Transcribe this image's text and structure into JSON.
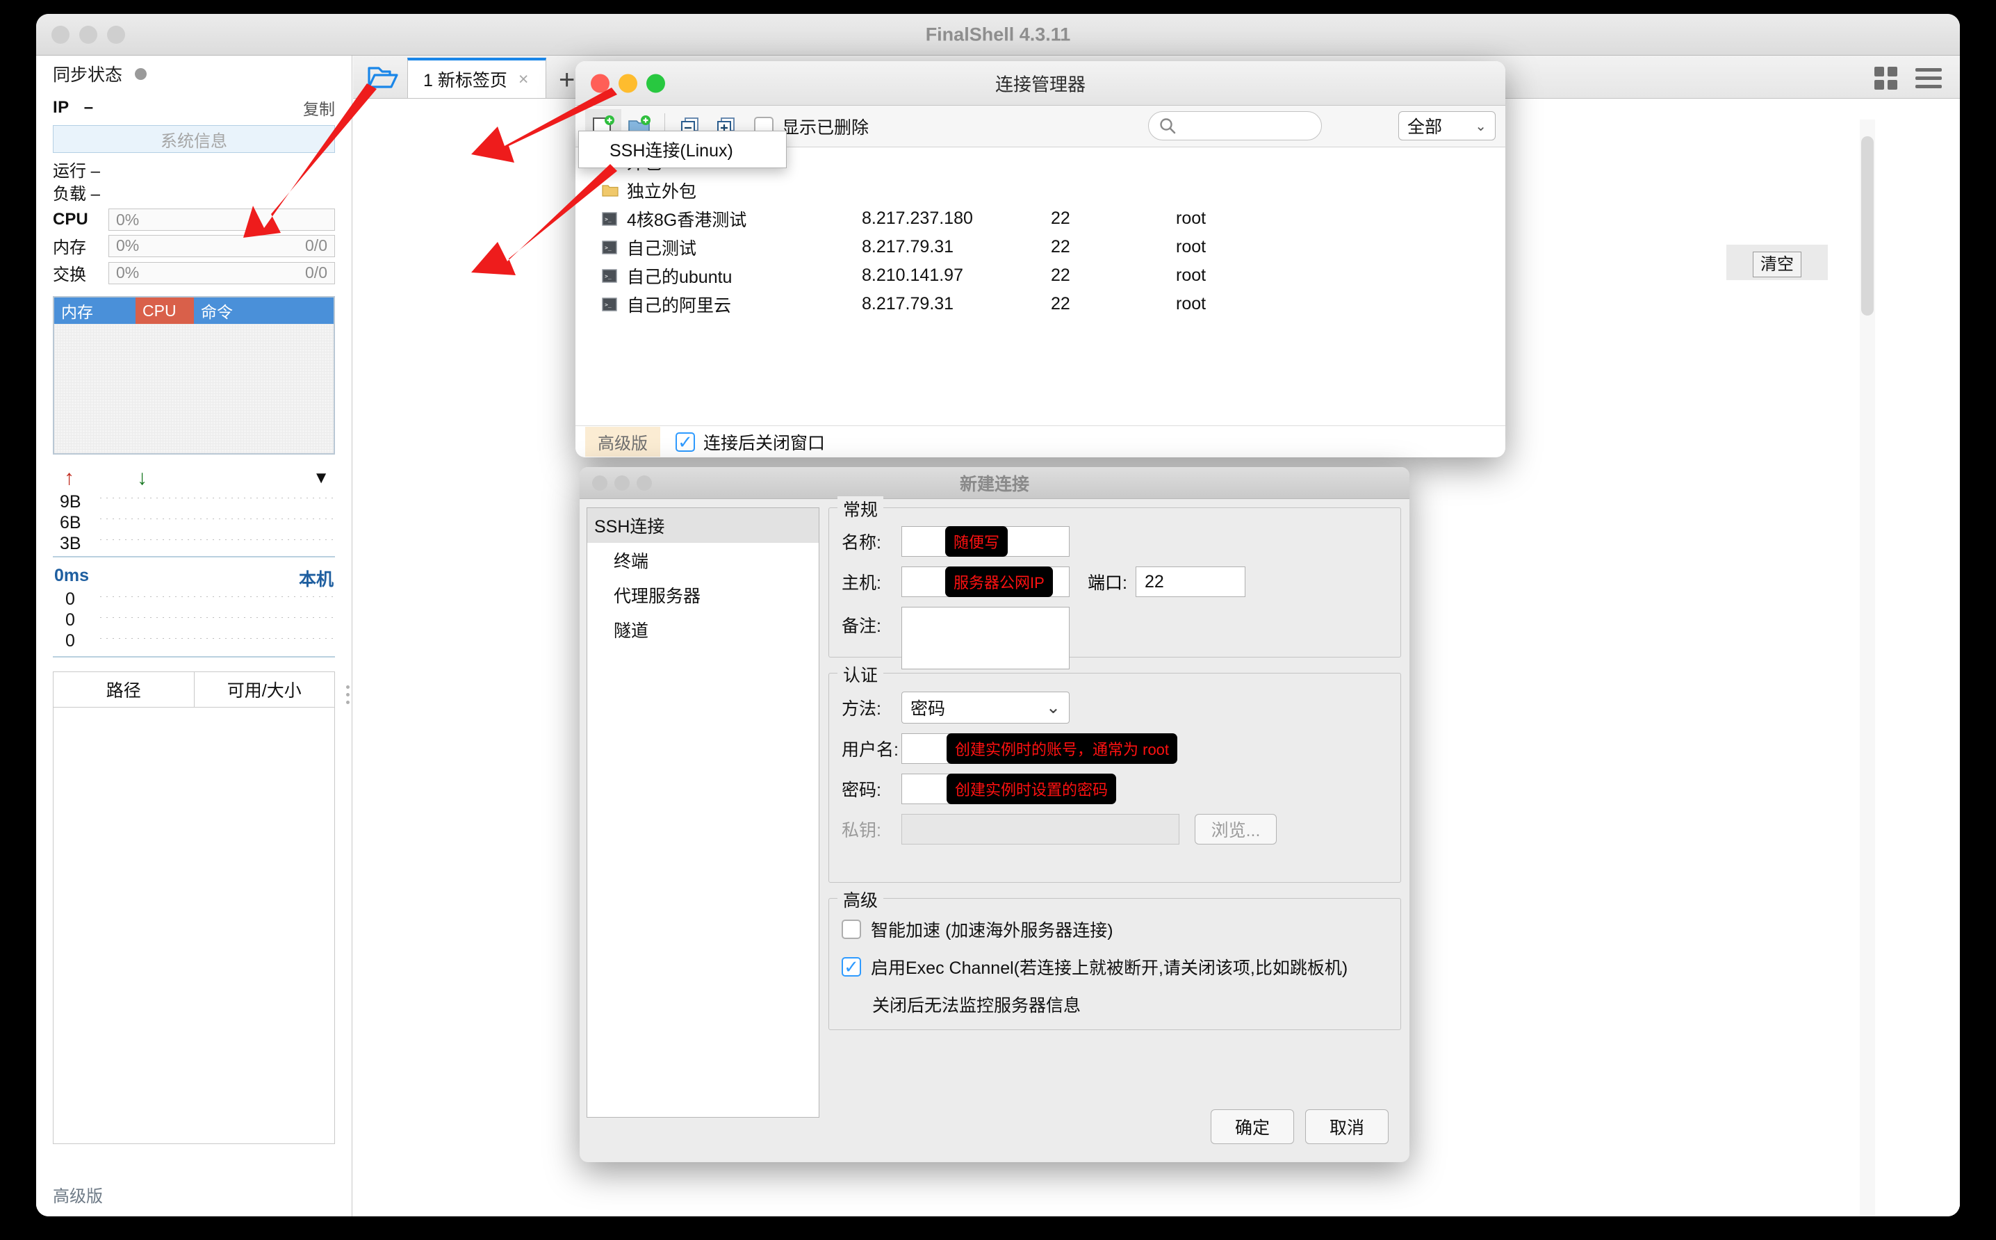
{
  "app": {
    "title": "FinalShell 4.3.11",
    "traffic_lights": [
      "close",
      "minimize",
      "maximize"
    ]
  },
  "sidebar": {
    "sync_status_label": "同步状态",
    "ip_label": "IP",
    "ip_value": "–",
    "copy_label": "复制",
    "system_info_button": "系统信息",
    "runtime_label": "运行 –",
    "load_label": "负载 –",
    "meters": [
      {
        "name": "CPU",
        "value": "0%",
        "right": ""
      },
      {
        "name": "内存",
        "value": "0%",
        "right": "0/0"
      },
      {
        "name": "交换",
        "value": "0%",
        "right": "0/0"
      }
    ],
    "process_table": {
      "headers": [
        "内存",
        "CPU",
        "命令"
      ],
      "rows": []
    },
    "net_graph": {
      "up_arrow": "↑",
      "down_arrow": "↓",
      "caret": "▼",
      "y_labels": [
        "9B",
        "6B",
        "3B"
      ]
    },
    "latency_graph": {
      "value": "0ms",
      "host_label": "本机",
      "y_labels": [
        "0",
        "0",
        "0"
      ]
    },
    "path_table": {
      "headers": [
        "路径",
        "可用/大小"
      ],
      "rows": []
    },
    "footer_badge": "高级版"
  },
  "tabbar": {
    "folder_icon": "open-folder-icon",
    "tabs": [
      {
        "label": "1 新标签页",
        "close": "×"
      }
    ],
    "add_tab": "+",
    "right_icons": [
      "grid-view-icon",
      "menu-icon"
    ]
  },
  "terminal": {
    "clear_button": "清空"
  },
  "connection_manager": {
    "title": "连接管理器",
    "toolbar": {
      "new_connection_icon": "new-connection-icon",
      "new_folder_icon": "new-folder-icon",
      "collapse_all_icon": "collapse-all-icon",
      "expand_all_icon": "expand-all-icon",
      "show_deleted_label": "显示已删除",
      "show_deleted_checked": false,
      "search_placeholder": "",
      "search_value": "",
      "filter_value": "全部"
    },
    "context_menu": {
      "items": [
        "SSH连接(Linux)"
      ]
    },
    "rows": [
      {
        "type": "folder",
        "expander": "›",
        "name": "外包",
        "host": "",
        "port": "",
        "user": ""
      },
      {
        "type": "folder",
        "expander": "›",
        "name": "独立外包",
        "host": "",
        "port": "",
        "user": ""
      },
      {
        "type": "server",
        "expander": "",
        "name": "4核8G香港测试",
        "host": "8.217.237.180",
        "port": "22",
        "user": "root"
      },
      {
        "type": "server",
        "expander": "",
        "name": "自己测试",
        "host": "8.217.79.31",
        "port": "22",
        "user": "root"
      },
      {
        "type": "server",
        "expander": "",
        "name": "自己的ubuntu",
        "host": "8.210.141.97",
        "port": "22",
        "user": "root"
      },
      {
        "type": "server",
        "expander": "",
        "name": "自己的阿里云",
        "host": "8.217.79.31",
        "port": "22",
        "user": "root"
      }
    ],
    "footer": {
      "advanced_badge": "高级版",
      "close_after_connect_label": "连接后关闭窗口",
      "close_after_connect_checked": true
    }
  },
  "new_connection": {
    "title": "新建连接",
    "nav": [
      {
        "label": "SSH连接",
        "selected": true
      },
      {
        "label": "终端",
        "selected": false
      },
      {
        "label": "代理服务器",
        "selected": false
      },
      {
        "label": "隧道",
        "selected": false
      }
    ],
    "general": {
      "legend": "常规",
      "name_label": "名称:",
      "name_value": "",
      "name_hint": "随便写",
      "host_label": "主机:",
      "host_value": "",
      "host_hint": "服务器公网IP",
      "port_label": "端口:",
      "port_value": "22",
      "remark_label": "备注:",
      "remark_value": ""
    },
    "auth": {
      "legend": "认证",
      "method_label": "方法:",
      "method_value": "密码",
      "username_label": "用户名:",
      "username_value": "",
      "username_hint": "创建实例时的账号，通常为 root",
      "password_label": "密码:",
      "password_value": "",
      "password_hint": "创建实例时设置的密码",
      "privatekey_label": "私钥:",
      "privatekey_value": "",
      "browse_button": "浏览..."
    },
    "advanced": {
      "legend": "高级",
      "smart_accel_label": "智能加速 (加速海外服务器连接)",
      "smart_accel_checked": false,
      "exec_channel_label": "启用Exec Channel(若连接上就被断开,请关闭该项,比如跳板机)",
      "exec_channel_checked": true,
      "note": "关闭后无法监控服务器信息"
    },
    "buttons": {
      "ok": "确定",
      "cancel": "取消"
    }
  },
  "colors": {
    "accent_blue": "#1a86e8",
    "mem_header": "#4a90d9",
    "cpu_header": "#d9604a",
    "annotation_red": "#ff1111",
    "arrow_red": "#ee1c1c"
  }
}
